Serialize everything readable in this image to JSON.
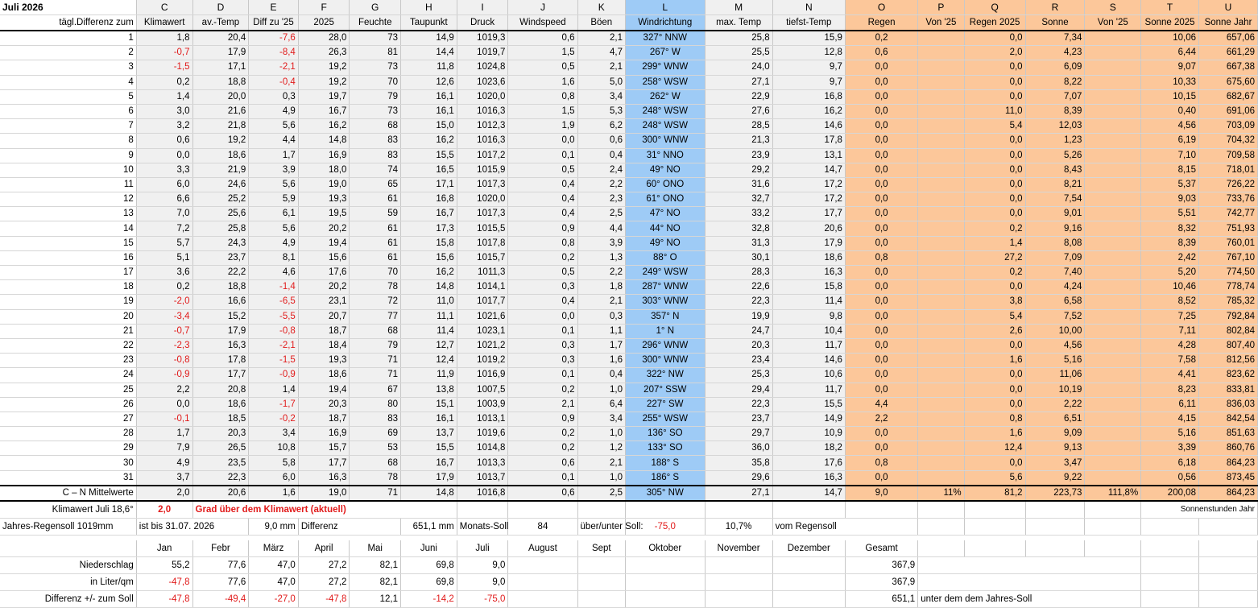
{
  "title": "Juli 2026",
  "columns": {
    "letters": [
      "C",
      "D",
      "E",
      "F",
      "G",
      "H",
      "I",
      "J",
      "K",
      "L",
      "M",
      "N",
      "O",
      "P",
      "Q",
      "R",
      "S",
      "T",
      "U"
    ],
    "row_label": "tägl.Differenz zum",
    "headers": [
      "Klimawert",
      "av.-Temp",
      "Diff zu '25",
      "2025",
      "Feuchte",
      "Taupunkt",
      "Druck",
      "Windspeed",
      "Böen",
      "Windrichtung",
      "max. Temp",
      "tiefst-Temp",
      "Regen",
      "Von '25",
      "Regen 2025",
      "Sonne",
      "Von '25",
      "Sonne 2025",
      "Sonne Jahr"
    ]
  },
  "rows": [
    [
      "1",
      "1,8",
      "20,4",
      "-7,6",
      "28,0",
      "73",
      "14,9",
      "1019,3",
      "0,6",
      "2,1",
      "327° NNW",
      "25,8",
      "15,9",
      "0,2",
      "",
      "0,0",
      "7,34",
      "",
      "10,06",
      "657,06"
    ],
    [
      "2",
      "-0,7",
      "17,9",
      "-8,4",
      "26,3",
      "81",
      "14,4",
      "1019,7",
      "1,5",
      "4,7",
      "267° W",
      "25,5",
      "12,8",
      "0,6",
      "",
      "2,0",
      "4,23",
      "",
      "6,44",
      "661,29"
    ],
    [
      "3",
      "-1,5",
      "17,1",
      "-2,1",
      "19,2",
      "73",
      "11,8",
      "1024,8",
      "0,5",
      "2,1",
      "299° WNW",
      "24,0",
      "9,7",
      "0,0",
      "",
      "0,0",
      "6,09",
      "",
      "9,07",
      "667,38"
    ],
    [
      "4",
      "0,2",
      "18,8",
      "-0,4",
      "19,2",
      "70",
      "12,6",
      "1023,6",
      "1,6",
      "5,0",
      "258° WSW",
      "27,1",
      "9,7",
      "0,0",
      "",
      "0,0",
      "8,22",
      "",
      "10,33",
      "675,60"
    ],
    [
      "5",
      "1,4",
      "20,0",
      "0,3",
      "19,7",
      "79",
      "16,1",
      "1020,0",
      "0,8",
      "3,4",
      "262° W",
      "22,9",
      "16,8",
      "0,0",
      "",
      "0,0",
      "7,07",
      "",
      "10,15",
      "682,67"
    ],
    [
      "6",
      "3,0",
      "21,6",
      "4,9",
      "16,7",
      "73",
      "16,1",
      "1016,3",
      "1,5",
      "5,3",
      "248° WSW",
      "27,6",
      "16,2",
      "0,0",
      "",
      "11,0",
      "8,39",
      "",
      "0,40",
      "691,06"
    ],
    [
      "7",
      "3,2",
      "21,8",
      "5,6",
      "16,2",
      "68",
      "15,0",
      "1012,3",
      "1,9",
      "6,2",
      "248° WSW",
      "28,5",
      "14,6",
      "0,0",
      "",
      "5,4",
      "12,03",
      "",
      "4,56",
      "703,09"
    ],
    [
      "8",
      "0,6",
      "19,2",
      "4,4",
      "14,8",
      "83",
      "16,2",
      "1016,3",
      "0,0",
      "0,6",
      "300° WNW",
      "21,3",
      "17,8",
      "0,0",
      "",
      "0,0",
      "1,23",
      "",
      "6,19",
      "704,32"
    ],
    [
      "9",
      "0,0",
      "18,6",
      "1,7",
      "16,9",
      "83",
      "15,5",
      "1017,2",
      "0,1",
      "0,4",
      "31° NNO",
      "23,9",
      "13,1",
      "0,0",
      "",
      "0,0",
      "5,26",
      "",
      "7,10",
      "709,58"
    ],
    [
      "10",
      "3,3",
      "21,9",
      "3,9",
      "18,0",
      "74",
      "16,5",
      "1015,9",
      "0,5",
      "2,4",
      "49° NO",
      "29,2",
      "14,7",
      "0,0",
      "",
      "0,0",
      "8,43",
      "",
      "8,15",
      "718,01"
    ],
    [
      "11",
      "6,0",
      "24,6",
      "5,6",
      "19,0",
      "65",
      "17,1",
      "1017,3",
      "0,4",
      "2,2",
      "60° ONO",
      "31,6",
      "17,2",
      "0,0",
      "",
      "0,0",
      "8,21",
      "",
      "5,37",
      "726,22"
    ],
    [
      "12",
      "6,6",
      "25,2",
      "5,9",
      "19,3",
      "61",
      "16,8",
      "1020,0",
      "0,4",
      "2,3",
      "61° ONO",
      "32,7",
      "17,2",
      "0,0",
      "",
      "0,0",
      "7,54",
      "",
      "9,03",
      "733,76"
    ],
    [
      "13",
      "7,0",
      "25,6",
      "6,1",
      "19,5",
      "59",
      "16,7",
      "1017,3",
      "0,4",
      "2,5",
      "47° NO",
      "33,2",
      "17,7",
      "0,0",
      "",
      "0,0",
      "9,01",
      "",
      "5,51",
      "742,77"
    ],
    [
      "14",
      "7,2",
      "25,8",
      "5,6",
      "20,2",
      "61",
      "17,3",
      "1015,5",
      "0,9",
      "4,4",
      "44° NO",
      "32,8",
      "20,6",
      "0,0",
      "",
      "0,2",
      "9,16",
      "",
      "8,32",
      "751,93"
    ],
    [
      "15",
      "5,7",
      "24,3",
      "4,9",
      "19,4",
      "61",
      "15,8",
      "1017,8",
      "0,8",
      "3,9",
      "49° NO",
      "31,3",
      "17,9",
      "0,0",
      "",
      "1,4",
      "8,08",
      "",
      "8,39",
      "760,01"
    ],
    [
      "16",
      "5,1",
      "23,7",
      "8,1",
      "15,6",
      "61",
      "15,6",
      "1015,7",
      "0,2",
      "1,3",
      "88° O",
      "30,1",
      "18,6",
      "0,8",
      "",
      "27,2",
      "7,09",
      "",
      "2,42",
      "767,10"
    ],
    [
      "17",
      "3,6",
      "22,2",
      "4,6",
      "17,6",
      "70",
      "16,2",
      "1011,3",
      "0,5",
      "2,2",
      "249° WSW",
      "28,3",
      "16,3",
      "0,0",
      "",
      "0,2",
      "7,40",
      "",
      "5,20",
      "774,50"
    ],
    [
      "18",
      "0,2",
      "18,8",
      "-1,4",
      "20,2",
      "78",
      "14,8",
      "1014,1",
      "0,3",
      "1,8",
      "287° WNW",
      "22,6",
      "15,8",
      "0,0",
      "",
      "0,0",
      "4,24",
      "",
      "10,46",
      "778,74"
    ],
    [
      "19",
      "-2,0",
      "16,6",
      "-6,5",
      "23,1",
      "72",
      "11,0",
      "1017,7",
      "0,4",
      "2,1",
      "303° WNW",
      "22,3",
      "11,4",
      "0,0",
      "",
      "3,8",
      "6,58",
      "",
      "8,52",
      "785,32"
    ],
    [
      "20",
      "-3,4",
      "15,2",
      "-5,5",
      "20,7",
      "77",
      "11,1",
      "1021,6",
      "0,0",
      "0,3",
      "357° N",
      "19,9",
      "9,8",
      "0,0",
      "",
      "5,4",
      "7,52",
      "",
      "7,25",
      "792,84"
    ],
    [
      "21",
      "-0,7",
      "17,9",
      "-0,8",
      "18,7",
      "68",
      "11,4",
      "1023,1",
      "0,1",
      "1,1",
      "1° N",
      "24,7",
      "10,4",
      "0,0",
      "",
      "2,6",
      "10,00",
      "",
      "7,11",
      "802,84"
    ],
    [
      "22",
      "-2,3",
      "16,3",
      "-2,1",
      "18,4",
      "79",
      "12,7",
      "1021,2",
      "0,3",
      "1,7",
      "296° WNW",
      "20,3",
      "11,7",
      "0,0",
      "",
      "0,0",
      "4,56",
      "",
      "4,28",
      "807,40"
    ],
    [
      "23",
      "-0,8",
      "17,8",
      "-1,5",
      "19,3",
      "71",
      "12,4",
      "1019,2",
      "0,3",
      "1,6",
      "300° WNW",
      "23,4",
      "14,6",
      "0,0",
      "",
      "1,6",
      "5,16",
      "",
      "7,58",
      "812,56"
    ],
    [
      "24",
      "-0,9",
      "17,7",
      "-0,9",
      "18,6",
      "71",
      "11,9",
      "1016,9",
      "0,1",
      "0,4",
      "322° NW",
      "25,3",
      "10,6",
      "0,0",
      "",
      "0,0",
      "11,06",
      "",
      "4,41",
      "823,62"
    ],
    [
      "25",
      "2,2",
      "20,8",
      "1,4",
      "19,4",
      "67",
      "13,8",
      "1007,5",
      "0,2",
      "1,0",
      "207° SSW",
      "29,4",
      "11,7",
      "0,0",
      "",
      "0,0",
      "10,19",
      "",
      "8,23",
      "833,81"
    ],
    [
      "26",
      "0,0",
      "18,6",
      "-1,7",
      "20,3",
      "80",
      "15,1",
      "1003,9",
      "2,1",
      "6,4",
      "227° SW",
      "22,3",
      "15,5",
      "4,4",
      "",
      "0,0",
      "2,22",
      "",
      "6,11",
      "836,03"
    ],
    [
      "27",
      "-0,1",
      "18,5",
      "-0,2",
      "18,7",
      "83",
      "16,1",
      "1013,1",
      "0,9",
      "3,4",
      "255° WSW",
      "23,7",
      "14,9",
      "2,2",
      "",
      "0,8",
      "6,51",
      "",
      "4,15",
      "842,54"
    ],
    [
      "28",
      "1,7",
      "20,3",
      "3,4",
      "16,9",
      "69",
      "13,7",
      "1019,6",
      "0,2",
      "1,0",
      "136° SO",
      "29,7",
      "10,9",
      "0,0",
      "",
      "1,6",
      "9,09",
      "",
      "5,16",
      "851,63"
    ],
    [
      "29",
      "7,9",
      "26,5",
      "10,8",
      "15,7",
      "53",
      "15,5",
      "1014,8",
      "0,2",
      "1,2",
      "133° SO",
      "36,0",
      "18,2",
      "0,0",
      "",
      "12,4",
      "9,13",
      "",
      "3,39",
      "860,76"
    ],
    [
      "30",
      "4,9",
      "23,5",
      "5,8",
      "17,7",
      "68",
      "16,7",
      "1013,3",
      "0,6",
      "2,1",
      "188° S",
      "35,8",
      "17,6",
      "0,8",
      "",
      "0,0",
      "3,47",
      "",
      "6,18",
      "864,23"
    ],
    [
      "31",
      "3,7",
      "22,3",
      "6,0",
      "16,3",
      "78",
      "17,9",
      "1013,7",
      "0,1",
      "1,0",
      "186° S",
      "29,6",
      "16,3",
      "0,0",
      "",
      "5,6",
      "9,22",
      "",
      "0,56",
      "873,45"
    ]
  ],
  "mean": {
    "label": "C – N Mittelwerte",
    "values": [
      "2,0",
      "20,6",
      "1,6",
      "19,0",
      "71",
      "14,8",
      "1016,8",
      "0,6",
      "2,5",
      "305° NW",
      "27,1",
      "14,7",
      "9,0",
      "11%",
      "81,2",
      "223,73",
      "111,8%",
      "200,08",
      "864,23"
    ]
  },
  "klima": {
    "label": "Klimawert Juli 18,6°",
    "value": "2,0",
    "text": "Grad über dem Klimawert (aktuell)",
    "sunnote": "Sonnenstunden Jahr"
  },
  "regen": {
    "label": "Jahres-Regensoll 1019mm",
    "bis": "ist bis 31.07. 2026",
    "amount": "9,0",
    "unit": "mm",
    "diff_label": "Differenz",
    "diff_value": "651,1",
    "diff_unit": "mm",
    "soll_label": "Monats-Soll",
    "soll_value": "84",
    "ueber_label": "über/unter Soll:",
    "ueber_value": "-75,0",
    "percent": "10,7%",
    "vom": "vom Regensoll"
  },
  "months": {
    "names": [
      "Jan",
      "Febr",
      "März",
      "April",
      "Mai",
      "Juni",
      "Juli",
      "August",
      "Sept",
      "Oktober",
      "November",
      "Dezember",
      "Gesamt"
    ],
    "rows": [
      {
        "label": "Niederschlag",
        "values": [
          "55,2",
          "77,6",
          "47,0",
          "27,2",
          "82,1",
          "69,8",
          "9,0"
        ],
        "total": "367,9",
        "note": ""
      },
      {
        "label": "in Liter/qm",
        "values": [
          "-47,8",
          "77,6",
          "47,0",
          "27,2",
          "82,1",
          "69,8",
          "9,0"
        ],
        "total": "367,9",
        "note": ""
      },
      {
        "label": "Differenz  +/- zum Soll",
        "values": [
          "-47,8",
          "-49,4",
          "-27,0",
          "-47,8",
          "12,1",
          "-14,2",
          "-75,0"
        ],
        "total": "651,1",
        "note": "unter dem dem Jahres-Soll"
      }
    ]
  },
  "colors": {
    "grey": "#f0f0f0",
    "blue": "#9ecbf6",
    "orange": "#fcc79a",
    "negative": "#e11b1b"
  }
}
